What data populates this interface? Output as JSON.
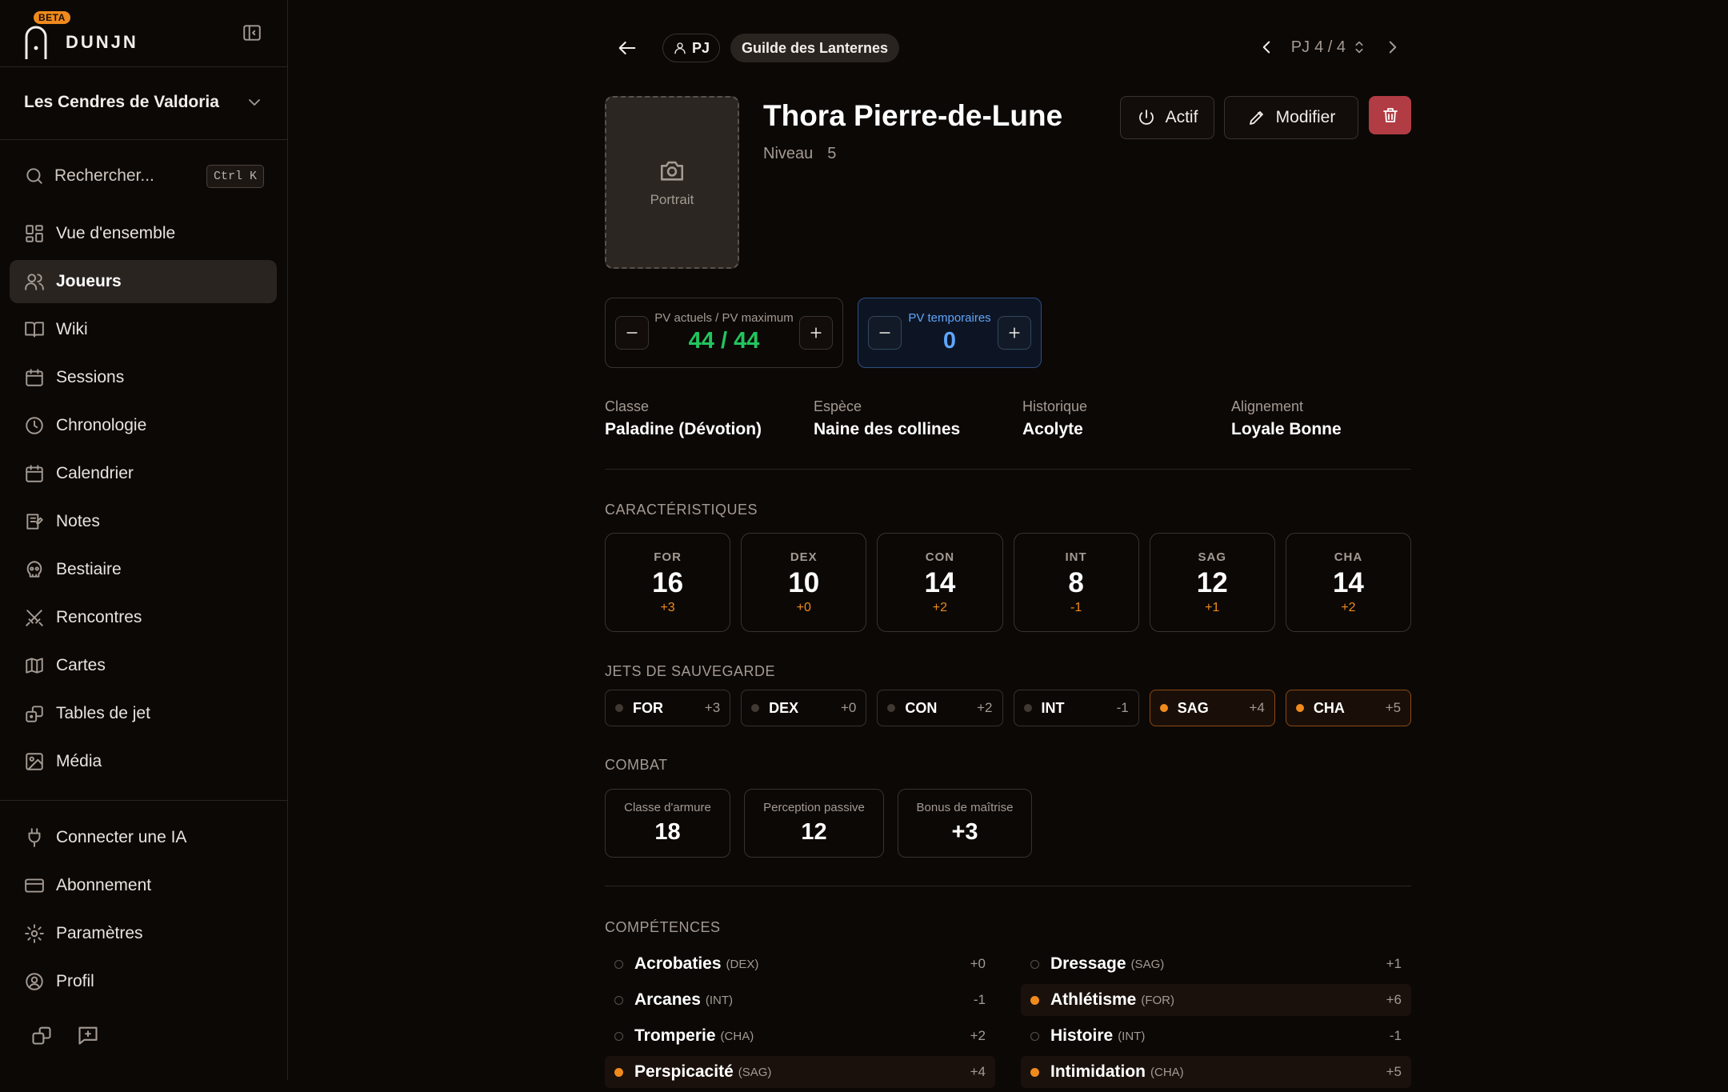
{
  "sidebar": {
    "beta": "BETA",
    "brand": "DUNJN",
    "campaign": "Les Cendres de Valdoria",
    "search": {
      "label": "Rechercher...",
      "shortcut": "Ctrl K"
    },
    "nav": [
      {
        "label": "Vue d'ensemble",
        "icon": "grid-icon",
        "active": false
      },
      {
        "label": "Joueurs",
        "icon": "users-icon",
        "active": true
      },
      {
        "label": "Wiki",
        "icon": "book-icon",
        "active": false
      },
      {
        "label": "Sessions",
        "icon": "calendar-icon",
        "active": false
      },
      {
        "label": "Chronologie",
        "icon": "clock-icon",
        "active": false
      },
      {
        "label": "Calendrier",
        "icon": "calendar-icon",
        "active": false
      },
      {
        "label": "Notes",
        "icon": "note-icon",
        "active": false
      },
      {
        "label": "Bestiaire",
        "icon": "skull-icon",
        "active": false
      },
      {
        "label": "Rencontres",
        "icon": "swords-icon",
        "active": false
      },
      {
        "label": "Cartes",
        "icon": "map-icon",
        "active": false
      },
      {
        "label": "Tables de jet",
        "icon": "dice-icon",
        "active": false
      },
      {
        "label": "Média",
        "icon": "image-icon",
        "active": false
      }
    ],
    "bottom_nav": [
      {
        "label": "Connecter une IA",
        "icon": "plug-icon"
      },
      {
        "label": "Abonnement",
        "icon": "credit-card-icon"
      },
      {
        "label": "Paramètres",
        "icon": "gear-icon"
      },
      {
        "label": "Profil",
        "icon": "user-circle-icon"
      }
    ]
  },
  "header": {
    "type_badge": "PJ",
    "group_badge": "Guilde des Lanternes",
    "pager": {
      "prefix": "PJ",
      "count": "4 / 4"
    }
  },
  "character": {
    "portrait_label": "Portrait",
    "name": "Thora Pierre-de-Lune",
    "level_label": "Niveau",
    "level": "5",
    "actions": {
      "active": "Actif",
      "edit": "Modifier"
    },
    "hp": {
      "label": "PV actuels / PV maximum",
      "value": "44 / 44"
    },
    "temp_hp": {
      "label": "PV temporaires",
      "value": "0"
    },
    "info": [
      {
        "label": "Classe",
        "value": "Paladine (Dévotion)"
      },
      {
        "label": "Espèce",
        "value": "Naine des collines"
      },
      {
        "label": "Historique",
        "value": "Acolyte"
      },
      {
        "label": "Alignement",
        "value": "Loyale Bonne"
      }
    ]
  },
  "sections": {
    "abilities": "CARACTÉRISTIQUES",
    "saves": "JETS DE SAUVEGARDE",
    "combat": "COMBAT",
    "skills": "COMPÉTENCES"
  },
  "abilities": [
    {
      "abbr": "FOR",
      "score": "16",
      "mod": "+3"
    },
    {
      "abbr": "DEX",
      "score": "10",
      "mod": "+0"
    },
    {
      "abbr": "CON",
      "score": "14",
      "mod": "+2"
    },
    {
      "abbr": "INT",
      "score": "8",
      "mod": "-1"
    },
    {
      "abbr": "SAG",
      "score": "12",
      "mod": "+1"
    },
    {
      "abbr": "CHA",
      "score": "14",
      "mod": "+2"
    }
  ],
  "saves": [
    {
      "abbr": "FOR",
      "mod": "+3",
      "proficient": false
    },
    {
      "abbr": "DEX",
      "mod": "+0",
      "proficient": false
    },
    {
      "abbr": "CON",
      "mod": "+2",
      "proficient": false
    },
    {
      "abbr": "INT",
      "mod": "-1",
      "proficient": false
    },
    {
      "abbr": "SAG",
      "mod": "+4",
      "proficient": true
    },
    {
      "abbr": "CHA",
      "mod": "+5",
      "proficient": true
    }
  ],
  "combat": [
    {
      "label": "Classe d'armure",
      "value": "18"
    },
    {
      "label": "Perception passive",
      "value": "12"
    },
    {
      "label": "Bonus de maîtrise",
      "value": "+3"
    }
  ],
  "skills_left": [
    {
      "name": "Acrobaties",
      "ability": "(DEX)",
      "mod": "+0",
      "proficient": false
    },
    {
      "name": "Arcanes",
      "ability": "(INT)",
      "mod": "-1",
      "proficient": false
    },
    {
      "name": "Tromperie",
      "ability": "(CHA)",
      "mod": "+2",
      "proficient": false
    },
    {
      "name": "Perspicacité",
      "ability": "(SAG)",
      "mod": "+4",
      "proficient": true
    }
  ],
  "skills_right": [
    {
      "name": "Dressage",
      "ability": "(SAG)",
      "mod": "+1",
      "proficient": false
    },
    {
      "name": "Athlétisme",
      "ability": "(FOR)",
      "mod": "+6",
      "proficient": true
    },
    {
      "name": "Histoire",
      "ability": "(INT)",
      "mod": "-1",
      "proficient": false
    },
    {
      "name": "Intimidation",
      "ability": "(CHA)",
      "mod": "+5",
      "proficient": true
    }
  ],
  "colors": {
    "accent": "#f08a1c",
    "hp": "#22c55e",
    "temp": "#60a5fa",
    "danger": "#b23c44",
    "bg": "#0c0806"
  }
}
